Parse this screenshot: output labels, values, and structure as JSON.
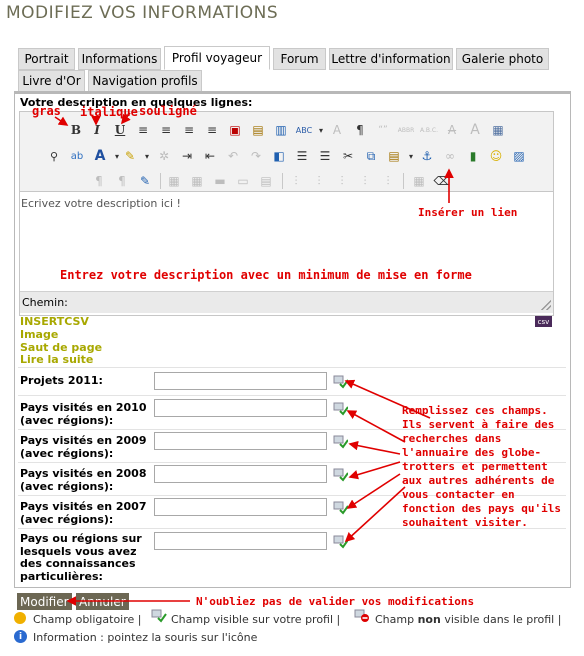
{
  "page_title": "MODIFIEZ VOS INFORMATIONS",
  "tabs": [
    {
      "label": "Portrait"
    },
    {
      "label": "Informations"
    },
    {
      "label": "Profil voyageur"
    },
    {
      "label": "Forum"
    },
    {
      "label": "Lettre d'information"
    },
    {
      "label": "Galerie photo"
    },
    {
      "label": "Livre d'Or"
    },
    {
      "label": "Navigation profils"
    }
  ],
  "editor": {
    "label": "Votre description en quelques lignes:",
    "placeholder": "Ecrivez votre description ici !",
    "path_label": "Chemin:"
  },
  "insert_links": [
    "INSERTCSV",
    "Image",
    "Saut de page",
    "Lire la suite"
  ],
  "fields": [
    {
      "label": "Projets 2011:",
      "value": ""
    },
    {
      "label": "Pays visités en 2010 (avec régions):",
      "value": ""
    },
    {
      "label": "Pays visités en 2009 (avec régions):",
      "value": ""
    },
    {
      "label": "Pays visités en 2008 (avec régions):",
      "value": ""
    },
    {
      "label": "Pays visités en 2007 (avec régions):",
      "value": ""
    },
    {
      "label": "Pays ou régions sur lesquels vous avez des connaissances particulières:",
      "value": ""
    }
  ],
  "buttons": {
    "submit": "Modifier",
    "cancel": "Annuler"
  },
  "legend": {
    "mandatory": "Champ obligatoire |",
    "visible": "Champ visible sur votre profil |",
    "not_visible_prefix": "Champ",
    "not_visible_bold": "non",
    "not_visible_suffix": "visible dans le profil |",
    "info": "Information : pointez la souris sur l'icône"
  },
  "annotations": {
    "gras": "gras",
    "italique": "italique",
    "souligne": "souligné",
    "inserer_lien": "Insérer un lien",
    "description_hint": "Entrez votre description avec un minimum de mise en forme",
    "fields_hint": "Remplissez ces champs. Ils servent à faire des recherches dans l'annuaire des globe-trotters et permettent aux autres adhérents de vous contacter en fonction des pays qu'ils souhaitent visiter.",
    "validate": "N'oubliez pas de valider vos modifications"
  },
  "colors": {
    "title": "#6d6d55",
    "annotation": "#e00000",
    "button": "#6c6753",
    "insert": "#a8a800"
  }
}
